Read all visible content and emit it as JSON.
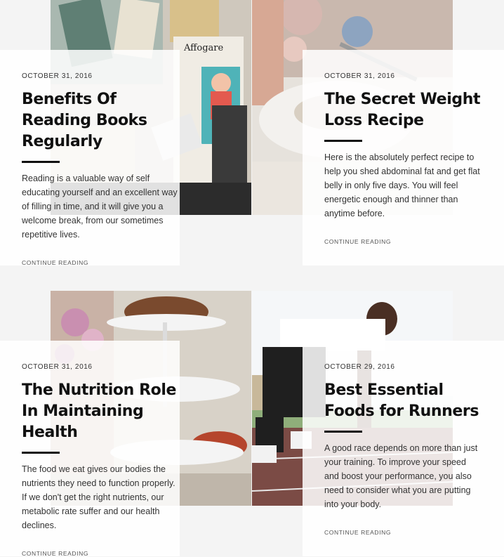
{
  "posts": [
    {
      "date": "OCTOBER 31, 2016",
      "title": "Benefits Of Reading Books Regularly",
      "excerpt": "Reading is a valuable way of self educating yourself and an excellent way of filling in time, and it will give you a welcome break, from our sometimes repetitive lives.",
      "more": "CONTINUE READING",
      "image_text": "Affogare"
    },
    {
      "date": "OCTOBER 31, 2016",
      "title": "The Secret Weight Loss Recipe",
      "excerpt": "Here is the absolutely perfect recipe to help you shed abdominal fat and get flat belly in only five days. You will feel energetic enough and thinner than anytime before.",
      "more": "CONTINUE READING"
    },
    {
      "date": "OCTOBER 31, 2016",
      "title": "The Nutrition Role In Maintaining Health",
      "excerpt": "The food we eat gives our bodies the nutrients they need to function properly. If we don't get the right nutrients, our metabolic rate suffer and our health declines.",
      "more": "CONTINUE READING"
    },
    {
      "date": "OCTOBER 29, 2016",
      "title": "Best Essential Foods for Runners",
      "excerpt": "A good race depends on more than just your training. To improve your speed and boost your performance, you also need to consider what you are putting into your body.",
      "more": "CONTINUE READING"
    }
  ]
}
